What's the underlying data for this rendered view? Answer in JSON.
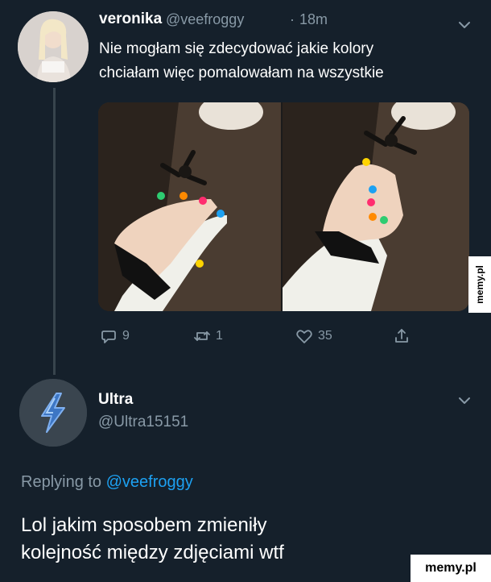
{
  "tweet": {
    "display_name": "veronika",
    "handle": "@veefroggy",
    "separator": "·",
    "time": "18m",
    "text_line1": "Nie mogłam się zdecydować jakie kolory",
    "text_line2": "chciałam więc pomalowałam na wszystkie",
    "actions": {
      "reply_count": "9",
      "retweet_count": "1",
      "like_count": "35"
    }
  },
  "reply": {
    "display_name": "Ultra",
    "handle": "@Ultra15151",
    "replying_prefix": "Replying to",
    "replying_handle": "@veefroggy",
    "text_line1": "Lol jakim sposobem zmieniły",
    "text_line2": "kolejność między zdjęciami wtf"
  },
  "watermarks": {
    "side": "memy.pl",
    "bottom": "memy.pl"
  },
  "colors": {
    "background": "#15202b",
    "muted": "#8899a6",
    "accent": "#1da1f2",
    "thread_line": "#38444d"
  },
  "icons": [
    "reply-icon",
    "retweet-icon",
    "like-icon",
    "share-icon",
    "chevron-down-icon",
    "lightning-icon"
  ]
}
